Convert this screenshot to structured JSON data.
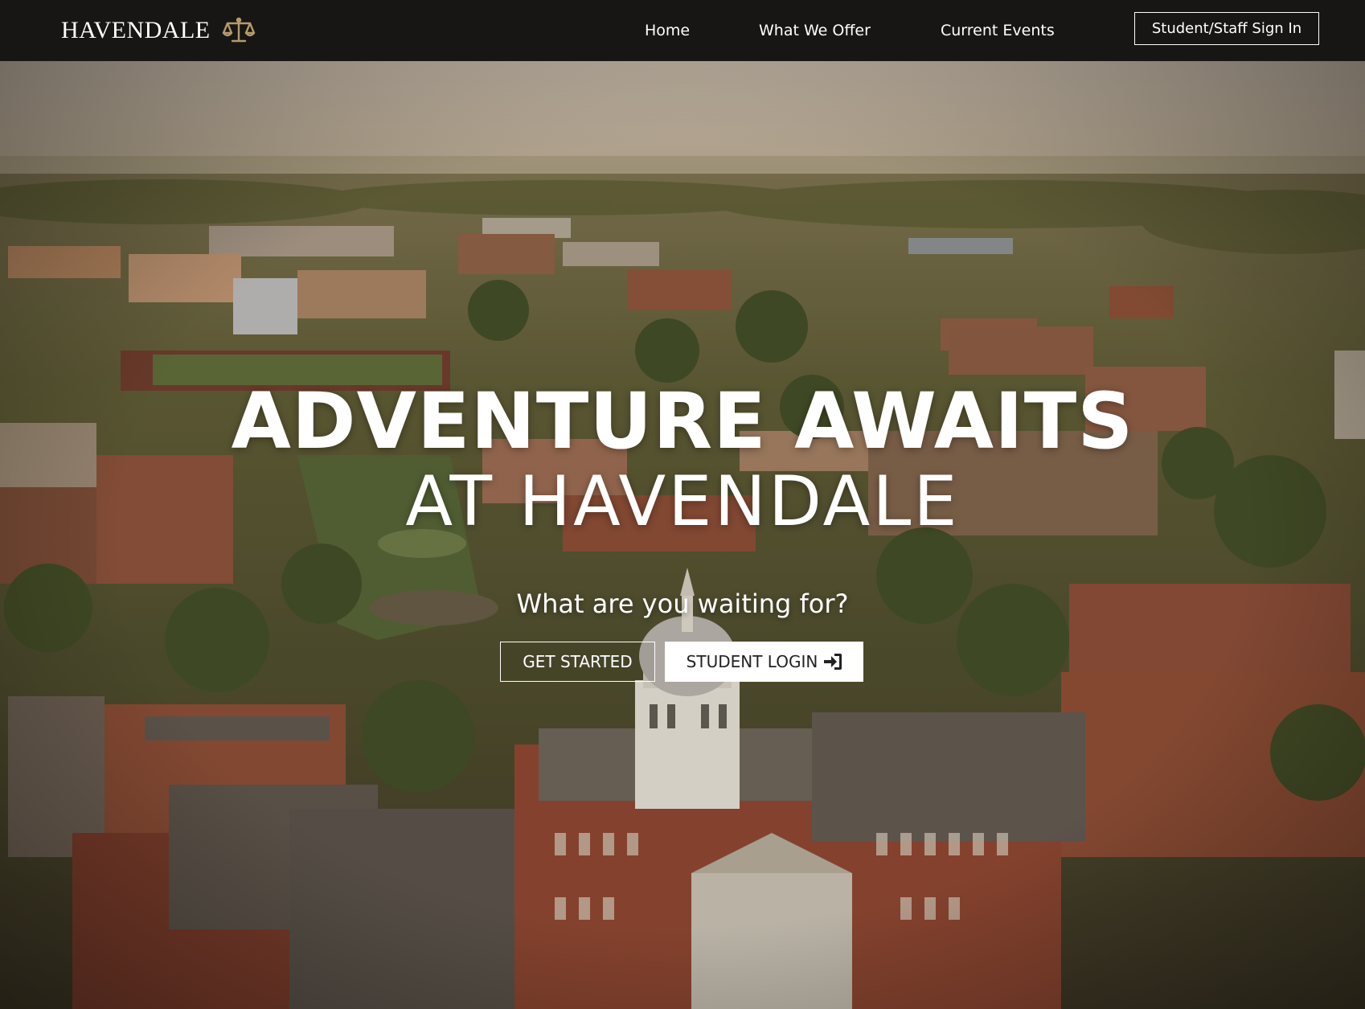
{
  "navbar": {
    "brand": "HAVENDALE",
    "brand_icon": "scales-icon",
    "links": [
      {
        "label": "Home"
      },
      {
        "label": "What We Offer"
      },
      {
        "label": "Current Events"
      }
    ],
    "signin_label": "Student/Staff Sign In"
  },
  "hero": {
    "headline_line1": "ADVENTURE AWAITS",
    "headline_line2": "AT HAVENDALE",
    "tagline": "What are you waiting for?",
    "get_started_label": "GET STARTED",
    "student_login_label": "STUDENT LOGIN",
    "student_login_icon": "sign-in-icon"
  },
  "colors": {
    "navbar_bg": "#171615",
    "brand_gold": "#b59a6a",
    "text_light": "#ffffff",
    "button_dark_text": "#222222"
  }
}
